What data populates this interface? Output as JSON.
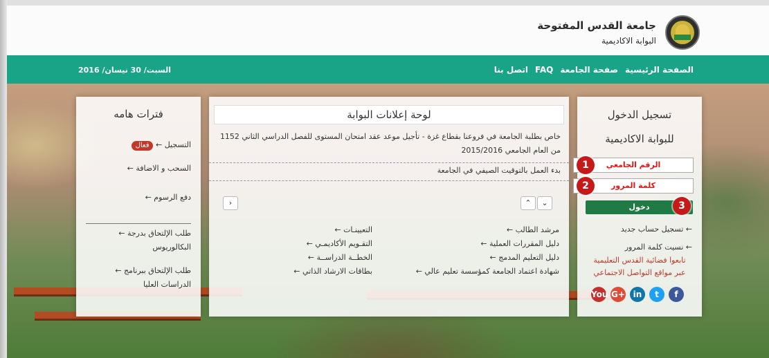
{
  "header": {
    "university": "جامعة القدس المفتوحة",
    "portal": "البوابة الاكاديمية"
  },
  "nav": {
    "items": [
      "الصفحة الرئيسية",
      "صفحة الجامعة",
      "FAQ",
      "اتصل بنا"
    ],
    "date": "السبت/ 30 نيسان/ 2016"
  },
  "login": {
    "title1": "تسجيل الدخول",
    "title2": "للبوابة الاكاديمية",
    "field1": "الرقم الجامعي",
    "field2": "كلمة المرور",
    "button": "دخول",
    "link_register": "تسجيل حساب جديد",
    "link_forgot": "نسيت كلمة المرور",
    "follow1": "تابعوا فضائية القدس التعليمية",
    "follow2": "عبر مواقع التواصل الاجتماعي",
    "badges": [
      "1",
      "2",
      "3"
    ],
    "social": [
      "f",
      "t",
      "in",
      "G+",
      "You"
    ]
  },
  "news": {
    "title": "لوحة إعلانات البوابة",
    "item1": "خاص بطلبة الجامعة في فروعنا بقطاع غزة - تأجيل موعد عقد امتحان المستوى للفصل الدراسي الثاني 1152 من العام الجامعي 2015/2016",
    "item2": "بدء العمل بالتوقيت الصيفي في الجامعة",
    "pager_up": "⌄",
    "pager_down": "⌃",
    "pager_left": "›",
    "linksA": [
      "← مرشد الطالب",
      "← دليل المقررات العملية",
      "← دليل التعليم المدمج",
      "← شهادة اعتماد الجامعة كمؤسسة تعليم عالي"
    ],
    "linksB": [
      "← التعيينـات",
      "← التقـويم الأكاديمـي",
      "← الخطــة الدراســة",
      "← بطاقات الارشاد الذاتي"
    ]
  },
  "terms": {
    "title": "فترات هامه",
    "item1": "← التسجيل",
    "item1_badge": "فعال",
    "item2": "← السحب و الاضافة",
    "item3": "← دفع الرسوم",
    "item4a": "← طلب الإلتحاق بدرجة",
    "item4b": "البكالوريوس",
    "item5a": "← طلب الإلتحاق ببرنامج",
    "item5b": "الدراسات العليا"
  }
}
